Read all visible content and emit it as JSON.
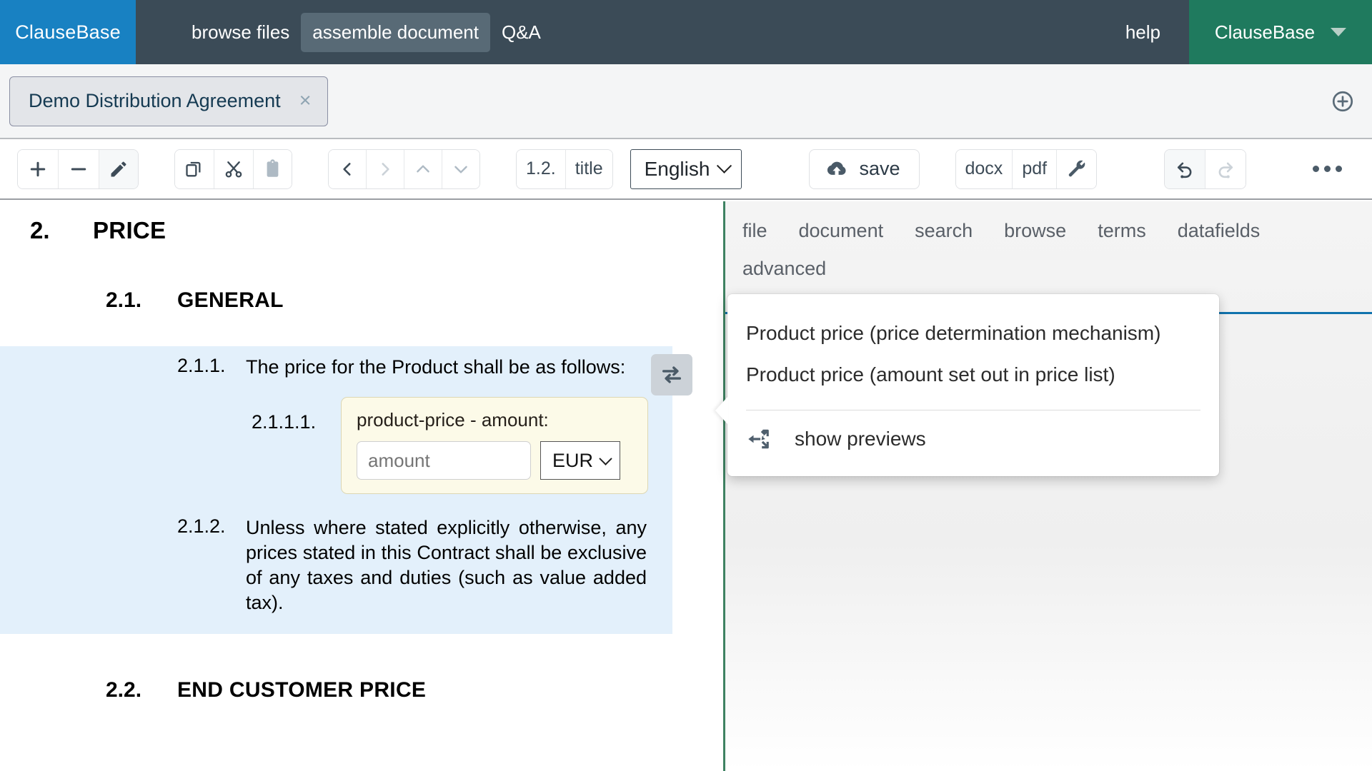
{
  "topnav": {
    "brand_left": "ClauseBase",
    "items": [
      {
        "label": "browse files",
        "active": false
      },
      {
        "label": "assemble document",
        "active": true
      },
      {
        "label": "Q&A",
        "active": false
      }
    ],
    "help": "help",
    "account": "ClauseBase",
    "caret_icon": "caret-down-icon",
    "colors": {
      "brand_blue": "#1881c2",
      "nav_bg": "#3b4b57",
      "account_green": "#1f7a5e"
    }
  },
  "tabbar": {
    "document_tab": "Demo Distribution Agreement",
    "close_icon": "×",
    "add_tab_icon": "plus-circle-icon"
  },
  "toolbar": {
    "group_edit": [
      {
        "name": "add-clause-button",
        "glyph": "+",
        "state": "enabled"
      },
      {
        "name": "remove-clause-button",
        "glyph": "−",
        "state": "enabled"
      },
      {
        "name": "edit-clause-button",
        "glyph": "pencil-icon",
        "state": "selected"
      }
    ],
    "group_clipboard": [
      {
        "name": "copy-button",
        "glyph": "copy-icon",
        "state": "enabled"
      },
      {
        "name": "cut-button",
        "glyph": "scissors-icon",
        "state": "enabled"
      },
      {
        "name": "paste-button",
        "glyph": "clipboard-icon",
        "state": "disabled"
      }
    ],
    "group_navigate": [
      {
        "name": "outdent-button",
        "glyph": "chevron-left-icon",
        "state": "enabled"
      },
      {
        "name": "indent-button",
        "glyph": "chevron-right-icon",
        "state": "disabled"
      },
      {
        "name": "move-up-button",
        "glyph": "chevron-up-icon",
        "state": "dim"
      },
      {
        "name": "move-down-button",
        "glyph": "chevron-down-icon",
        "state": "dim"
      }
    ],
    "numbering_label": "1.2.",
    "title_label": "title",
    "language": "English",
    "save_label": "save",
    "export_docx": "docx",
    "export_pdf": "pdf",
    "export_settings_icon": "wrench-icon",
    "undo_icon": "undo-icon",
    "redo_icon": "redo-icon",
    "more_icon": "ellipsis-icon"
  },
  "document": {
    "heading1": {
      "number": "2.",
      "text": "PRICE"
    },
    "heading2": {
      "number": "2.1.",
      "text": "GENERAL"
    },
    "clause_211": {
      "number": "2.1.1.",
      "text": "The price for the Product shall be as follows:"
    },
    "swap_icon": "swap-arrows-icon",
    "subclause_2111": {
      "number": "2.1.1.1.",
      "field_label": "product-price - amount:",
      "amount_value": "",
      "amount_placeholder": "amount",
      "currency": "EUR"
    },
    "clause_212": {
      "number": "2.1.2.",
      "text": "Unless where stated explicitly otherwise, any prices stated in this Contract shall be exclusive of any taxes and duties (such as value added tax)."
    },
    "heading2b": {
      "number": "2.2.",
      "text": "END CUSTOMER PRICE"
    }
  },
  "sidepane": {
    "tabs_row1": [
      "file",
      "document",
      "search",
      "browse",
      "terms",
      "datafields"
    ],
    "tabs_row2": [
      "advanced"
    ],
    "accent_rule_color": "#1173ad",
    "divider_color": "#3f8262"
  },
  "popup": {
    "options": [
      "Product price (price determination mechanism)",
      "Product price (amount set out in price list)"
    ],
    "action_label": "show previews",
    "action_icon": "expand-arrows-icon"
  }
}
